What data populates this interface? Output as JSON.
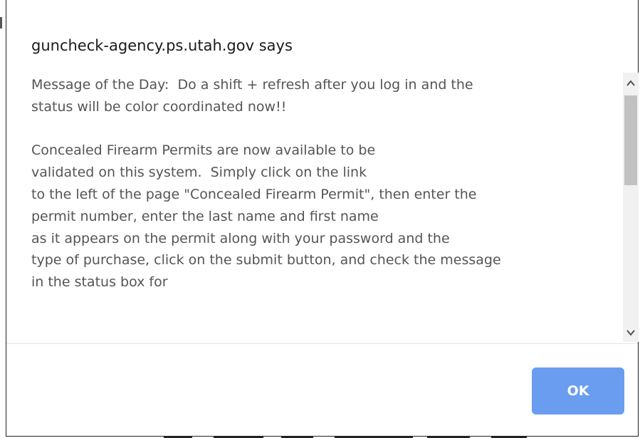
{
  "dialog": {
    "title": "guncheck-agency.ps.utah.gov says",
    "message": "Message of the Day:  Do a shift + refresh after you log in and the\nstatus will be color coordinated now!!\n\nConcealed Firearm Permits are now available to be\nvalidated on this system.  Simply click on the link\nto the left of the page \"Concealed Firearm Permit\", then enter the\npermit number, enter the last name and first name\nas it appears on the permit along with your password and the\ntype of purchase, click on the submit button, and check the message\nin the status box for",
    "ok_label": "OK"
  },
  "scrollbar": {
    "up_icon": "chevron-up-icon",
    "down_icon": "chevron-down-icon"
  },
  "colors": {
    "ok_button": "#6a9df0",
    "message_text": "#555555",
    "title_text": "#1a1a1a",
    "scroll_thumb": "#c1c1c1",
    "scroll_track": "#f1f1f1"
  }
}
